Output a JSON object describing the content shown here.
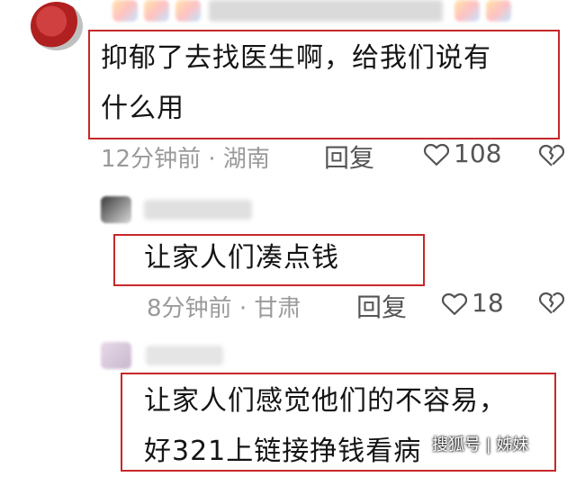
{
  "comments": [
    {
      "text_line1": "抑郁了去找医生啊，给我们说有",
      "text_line2": "什么用",
      "time": "12分钟前",
      "separator": "·",
      "location": "湖南",
      "reply_label": "回复",
      "likes": "108"
    },
    {
      "text_line1": "让家人们凑点钱",
      "time": "8分钟前",
      "separator": "·",
      "location": "甘肃",
      "reply_label": "回复",
      "likes": "18"
    },
    {
      "text_line1": "让家人们感觉他们的不容易，",
      "text_line2": "好321上链接挣钱看病"
    }
  ],
  "watermark": "搜狐号 | 姊妹",
  "colors": {
    "highlight_border": "#c62828",
    "meta_text": "#9a9a9a"
  },
  "icons": [
    "heart-icon",
    "broken-heart-icon"
  ]
}
